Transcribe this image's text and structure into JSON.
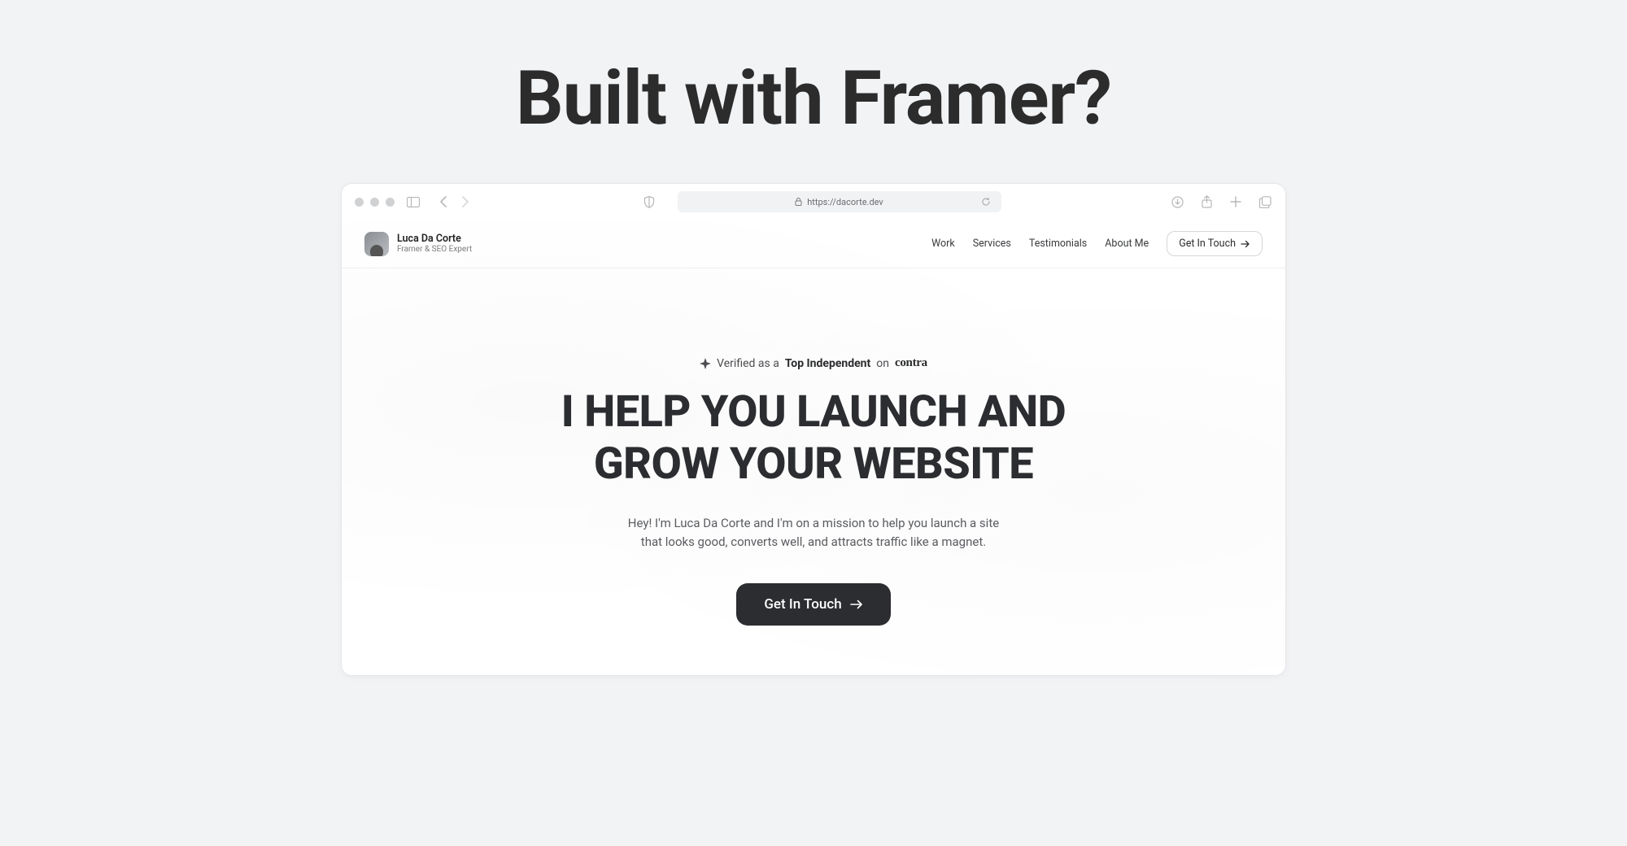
{
  "page": {
    "title": "Built with Framer?"
  },
  "browser": {
    "url": "https://dacorte.dev"
  },
  "site": {
    "brand": {
      "name": "Luca Da Corte",
      "tagline": "Framer & SEO Expert"
    },
    "nav": {
      "items": [
        "Work",
        "Services",
        "Testimonials",
        "About Me"
      ],
      "cta": "Get In Touch"
    },
    "hero": {
      "verified_prefix": "Verified as a",
      "verified_bold": "Top Independent",
      "verified_on": "on",
      "verified_platform": "contra",
      "title_line1": "I HELP YOU LAUNCH AND",
      "title_line2": "GROW YOUR WEBSITE",
      "sub_line1": "Hey! I'm Luca Da Corte and I'm on a mission to help you launch a site",
      "sub_line2": "that looks good, converts well, and attracts traffic like a magnet.",
      "cta": "Get In Touch"
    }
  }
}
